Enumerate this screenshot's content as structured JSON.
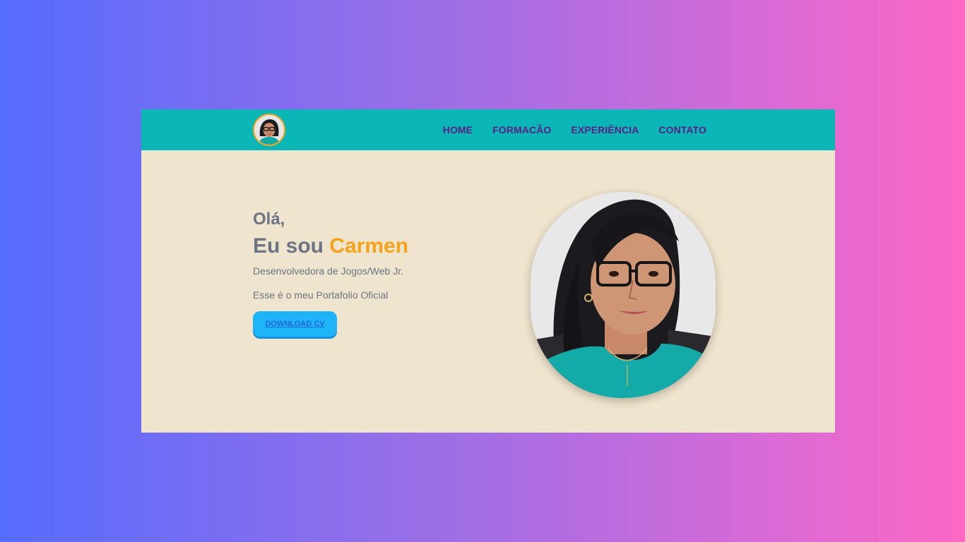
{
  "nav": {
    "links": [
      "HOME",
      "FORMACÃO",
      "EXPERIÊNCIA",
      "CONTATO"
    ]
  },
  "hero": {
    "greeting": "Olá,",
    "headline_prefix": "Eu sou",
    "name": "Carmen",
    "role": "Desenvolvedora de Jogos/Web Jr.",
    "tagline": "Esse é o meu Portafolio Oficial",
    "cta_label": "DOWNLOAD CV"
  },
  "colors": {
    "navbar": "#0bb6b7",
    "page_background": "#efe4cd",
    "nav_link": "#5a1f86",
    "accent_name": "#f7a21b",
    "button": "#1fb3f7",
    "text": "#6b7384"
  },
  "icons": {
    "nav_avatar": "profile-avatar-photo",
    "portrait": "profile-portrait-photo"
  }
}
